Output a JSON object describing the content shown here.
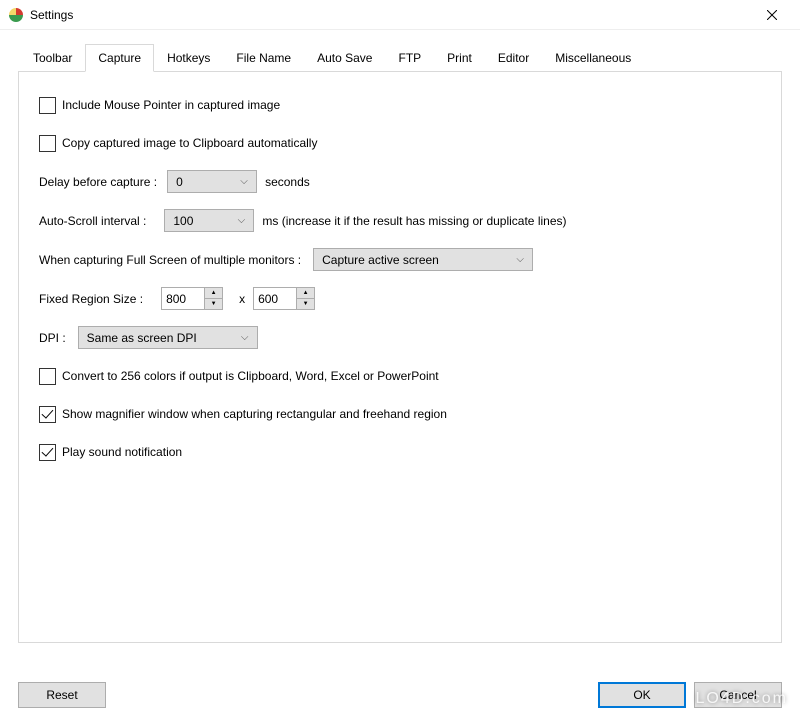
{
  "window": {
    "title": "Settings"
  },
  "tabs": {
    "items": [
      "Toolbar",
      "Capture",
      "Hotkeys",
      "File Name",
      "Auto Save",
      "FTP",
      "Print",
      "Editor",
      "Miscellaneous"
    ],
    "active_index": 1
  },
  "capture": {
    "include_pointer": {
      "label": "Include Mouse Pointer in captured image",
      "checked": false
    },
    "copy_clipboard": {
      "label": "Copy captured image to Clipboard automatically",
      "checked": false
    },
    "delay": {
      "label": "Delay before capture :",
      "value": "0",
      "suffix": "seconds"
    },
    "autoscroll": {
      "label": "Auto-Scroll interval :",
      "value": "100",
      "suffix": "ms (increase it if the result has missing or duplicate lines)"
    },
    "multimonitor": {
      "label": "When capturing Full Screen of multiple monitors :",
      "value": "Capture active screen"
    },
    "fixed_region": {
      "label": "Fixed Region Size :",
      "width": "800",
      "sep": "x",
      "height": "600"
    },
    "dpi": {
      "label": "DPI :",
      "value": "Same as screen DPI"
    },
    "convert256": {
      "label": "Convert to 256 colors if output is Clipboard, Word, Excel or PowerPoint",
      "checked": false
    },
    "magnifier": {
      "label": "Show magnifier window when capturing rectangular and freehand region",
      "checked": true
    },
    "sound": {
      "label": "Play sound notification",
      "checked": true
    }
  },
  "buttons": {
    "reset": "Reset",
    "ok": "OK",
    "cancel": "Cancel"
  },
  "watermark": "LO4D.com"
}
